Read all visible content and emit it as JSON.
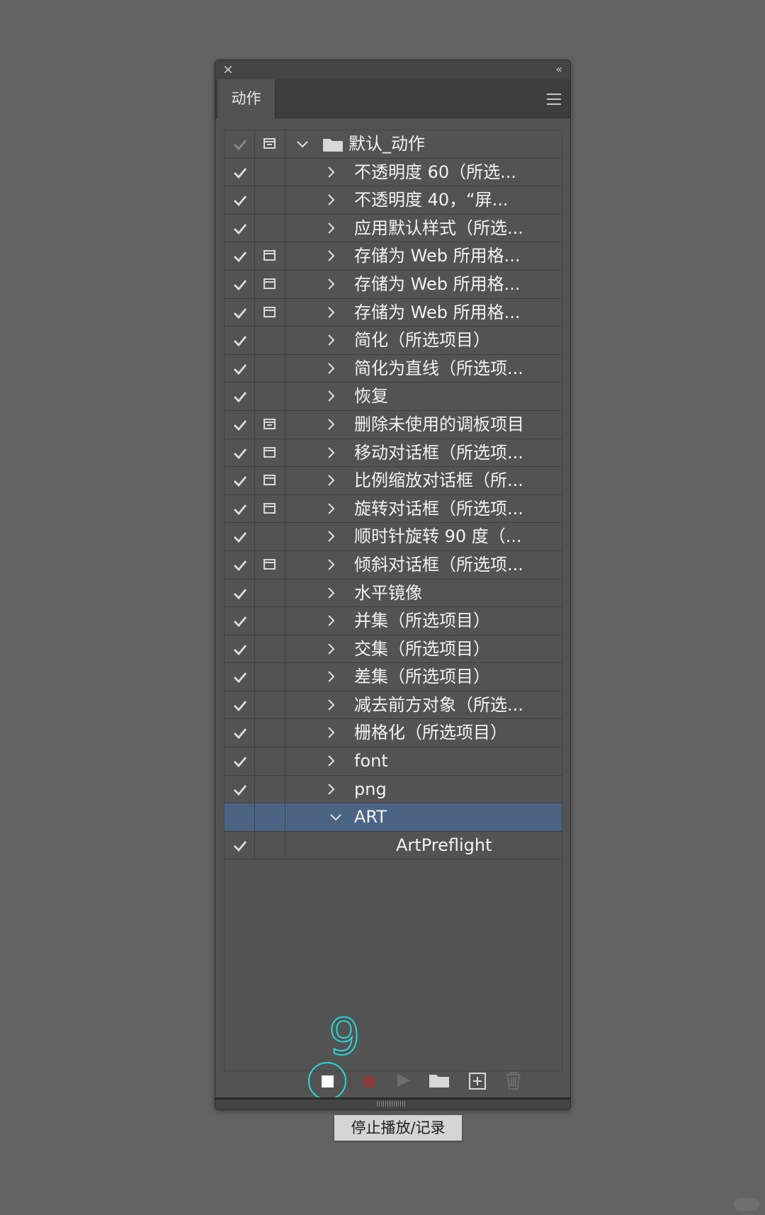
{
  "panel": {
    "tab_label": "动作",
    "close_glyph": "×",
    "collapse_glyph": "‹‹"
  },
  "set": {
    "label": "默认_动作",
    "expanded": true
  },
  "actions": [
    {
      "label": "不透明度 60（所选...",
      "checked": true,
      "dialog": "none"
    },
    {
      "label": "不透明度 40，“屏...",
      "checked": true,
      "dialog": "none"
    },
    {
      "label": "应用默认样式（所选...",
      "checked": true,
      "dialog": "none"
    },
    {
      "label": "存储为 Web 所用格...",
      "checked": true,
      "dialog": "on"
    },
    {
      "label": "存储为 Web 所用格...",
      "checked": true,
      "dialog": "on"
    },
    {
      "label": "存储为 Web 所用格...",
      "checked": true,
      "dialog": "on"
    },
    {
      "label": "简化（所选项目）",
      "checked": true,
      "dialog": "none"
    },
    {
      "label": "简化为直线（所选项...",
      "checked": true,
      "dialog": "none"
    },
    {
      "label": "恢复",
      "checked": true,
      "dialog": "none"
    },
    {
      "label": "删除未使用的调板项目",
      "checked": true,
      "dialog": "partial"
    },
    {
      "label": "移动对话框（所选项...",
      "checked": true,
      "dialog": "on"
    },
    {
      "label": "比例缩放对话框（所...",
      "checked": true,
      "dialog": "on"
    },
    {
      "label": "旋转对话框（所选项...",
      "checked": true,
      "dialog": "on"
    },
    {
      "label": "顺时针旋转 90 度（...",
      "checked": true,
      "dialog": "none"
    },
    {
      "label": "倾斜对话框（所选项...",
      "checked": true,
      "dialog": "on"
    },
    {
      "label": "水平镜像",
      "checked": true,
      "dialog": "none"
    },
    {
      "label": "并集（所选项目）",
      "checked": true,
      "dialog": "none"
    },
    {
      "label": "交集（所选项目）",
      "checked": true,
      "dialog": "none"
    },
    {
      "label": "差集（所选项目）",
      "checked": true,
      "dialog": "none"
    },
    {
      "label": "减去前方对象（所选...",
      "checked": true,
      "dialog": "none"
    },
    {
      "label": "栅格化（所选项目）",
      "checked": true,
      "dialog": "none"
    },
    {
      "label": "font",
      "checked": true,
      "dialog": "none"
    },
    {
      "label": "png",
      "checked": true,
      "dialog": "none"
    }
  ],
  "selected_action": {
    "label": "ART",
    "expanded": true
  },
  "step": {
    "label": "ArtPreflight",
    "checked": true
  },
  "annotation": {
    "step_number": "9"
  },
  "tooltip": {
    "text": "停止播放/记录"
  },
  "colors": {
    "accent": "#26d9d6",
    "selection": "#4c6484",
    "record": "#8b3a3a"
  }
}
